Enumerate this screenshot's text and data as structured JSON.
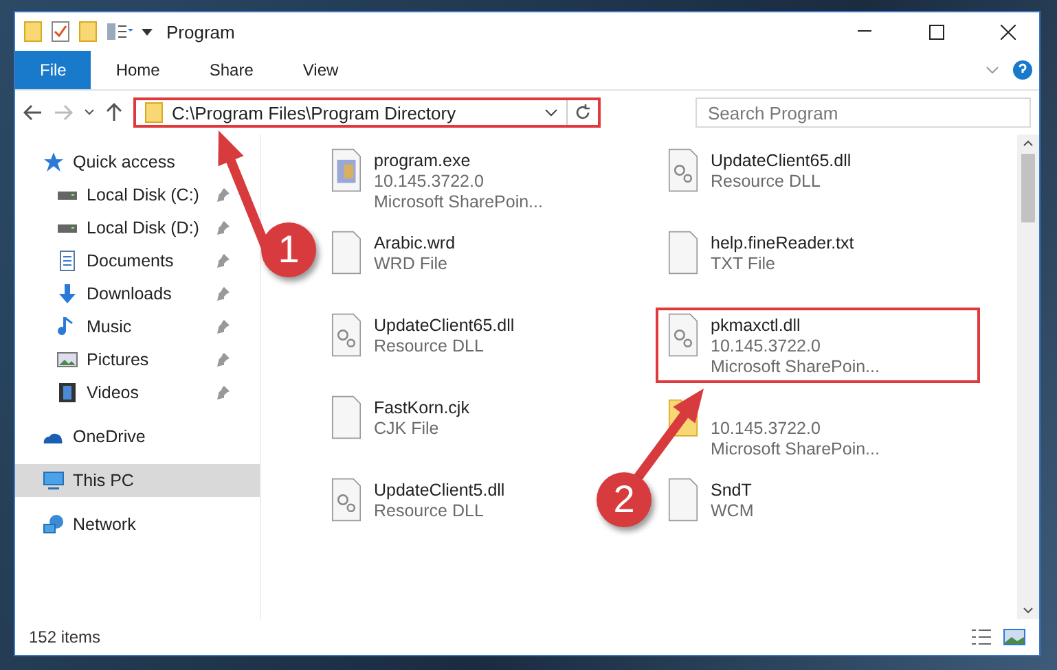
{
  "window": {
    "title": "Program"
  },
  "ribbon_tabs": [
    {
      "label": "File",
      "selected": true
    },
    {
      "label": "Home",
      "selected": false
    },
    {
      "label": "Share",
      "selected": false
    },
    {
      "label": "View",
      "selected": false
    }
  ],
  "address": {
    "path": "C:\\Program Files\\Program Directory",
    "highlighted": true
  },
  "search": {
    "placeholder": "Search Program"
  },
  "sidebar": [
    {
      "label": "Quick access",
      "kind": "star",
      "selected": false,
      "children": [
        {
          "label": "Local Disk (C:)",
          "kind": "drive",
          "pinned": true,
          "selected": false
        },
        {
          "label": "Local Disk (D:)",
          "kind": "drive",
          "pinned": true,
          "selected": false
        },
        {
          "label": "Documents",
          "kind": "docs",
          "pinned": true,
          "selected": false
        },
        {
          "label": "Downloads",
          "kind": "download",
          "pinned": true,
          "selected": false
        },
        {
          "label": "Music",
          "kind": "music",
          "pinned": true,
          "selected": false
        },
        {
          "label": "Pictures",
          "kind": "pictures",
          "pinned": true,
          "selected": false
        },
        {
          "label": "Videos",
          "kind": "videos",
          "pinned": true,
          "selected": false
        }
      ]
    },
    {
      "label": "OneDrive",
      "kind": "cloud",
      "selected": false
    },
    {
      "label": "This PC",
      "kind": "pc",
      "selected": true
    },
    {
      "label": "Network",
      "kind": "network",
      "selected": false
    }
  ],
  "files": [
    {
      "kind": "exe",
      "name": "program.exe",
      "details": [
        "10.145.3722.0",
        "Microsoft SharePoin..."
      ],
      "highlighted": false
    },
    {
      "kind": "dll",
      "name": "UpdateClient65.dll",
      "details": [
        "Resource DLL"
      ],
      "highlighted": false
    },
    {
      "kind": "doc",
      "name": "Arabic.wrd",
      "details": [
        "WRD File"
      ],
      "highlighted": false
    },
    {
      "kind": "doc",
      "name": "help.fineReader.txt",
      "details": [
        "TXT File"
      ],
      "highlighted": false
    },
    {
      "kind": "dll",
      "name": "UpdateClient65.dll",
      "details": [
        "Resource DLL"
      ],
      "highlighted": false
    },
    {
      "kind": "dll",
      "name": "pkmaxctl.dll",
      "details": [
        "10.145.3722.0",
        "Microsoft SharePoin..."
      ],
      "highlighted": true
    },
    {
      "kind": "doc",
      "name": "FastKorn.cjk",
      "details": [
        "CJK File"
      ],
      "highlighted": false
    },
    {
      "kind": "folder",
      "details": [
        "10.145.3722.0",
        "Microsoft SharePoin..."
      ],
      "highlighted": false
    },
    {
      "kind": "dll",
      "name": "UpdateClient5.dll",
      "details": [
        "Resource DLL"
      ],
      "highlighted": false
    },
    {
      "kind": "doc",
      "name": "SndT",
      "details": [
        "WCM"
      ],
      "highlighted": false
    }
  ],
  "status_bar": {
    "item_count": "152 items"
  },
  "callouts": [
    {
      "number": "1"
    },
    {
      "number": "2"
    }
  ]
}
